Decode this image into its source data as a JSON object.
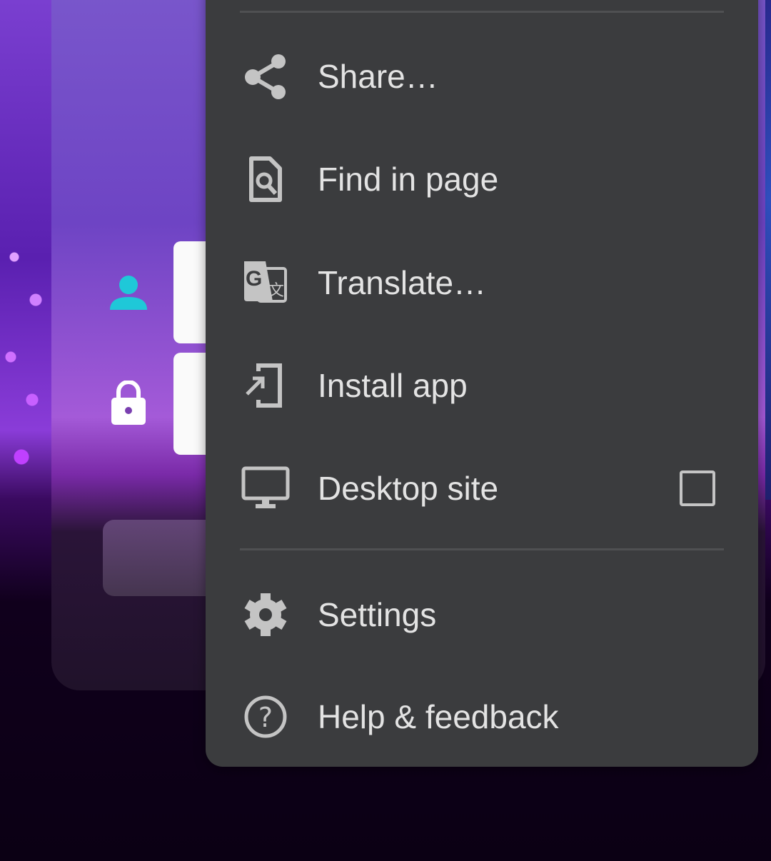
{
  "menu": {
    "items": [
      {
        "label": "Share…",
        "icon": "share-icon"
      },
      {
        "label": "Find in page",
        "icon": "find-in-page-icon"
      },
      {
        "label": "Translate…",
        "icon": "translate-icon"
      },
      {
        "label": "Install app",
        "icon": "install-app-icon"
      },
      {
        "label": "Desktop site",
        "icon": "desktop-icon",
        "checked": false
      },
      {
        "label": "Settings",
        "icon": "gear-icon"
      },
      {
        "label": "Help & feedback",
        "icon": "help-icon"
      }
    ]
  },
  "page": {
    "accent": "#1fc8d8",
    "username_icon": "user-icon",
    "password_icon": "lock-icon"
  }
}
